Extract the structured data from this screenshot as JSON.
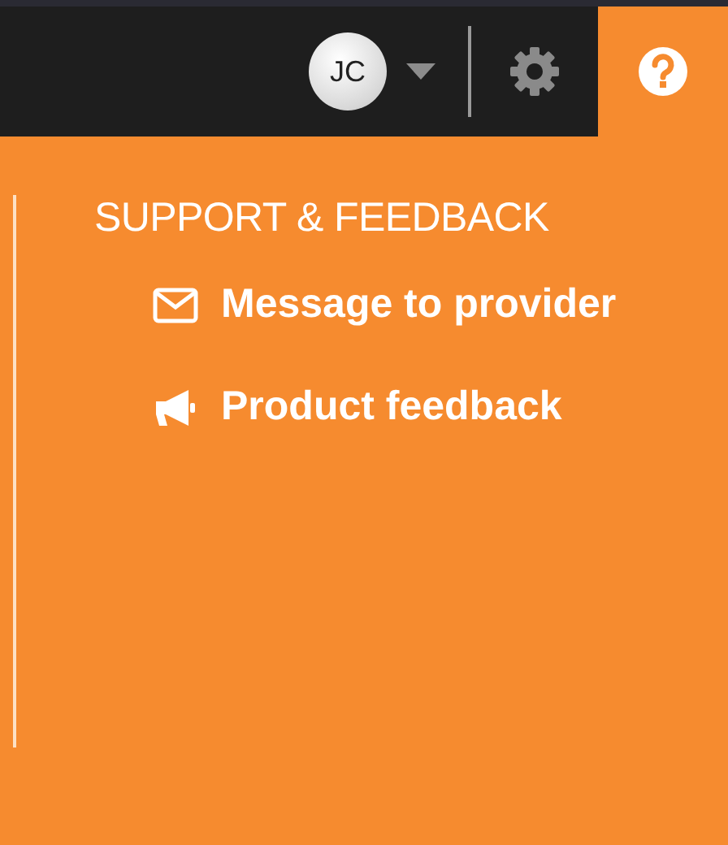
{
  "top_bar": {
    "avatar": {
      "initials": "JC"
    },
    "help_button": {
      "selected": true
    }
  },
  "support_panel": {
    "heading": "SUPPORT & FEEDBACK",
    "items": [
      {
        "kind": "mail",
        "label": "Message to provider"
      },
      {
        "kind": "megaphone",
        "label": "Product feedback"
      }
    ]
  }
}
